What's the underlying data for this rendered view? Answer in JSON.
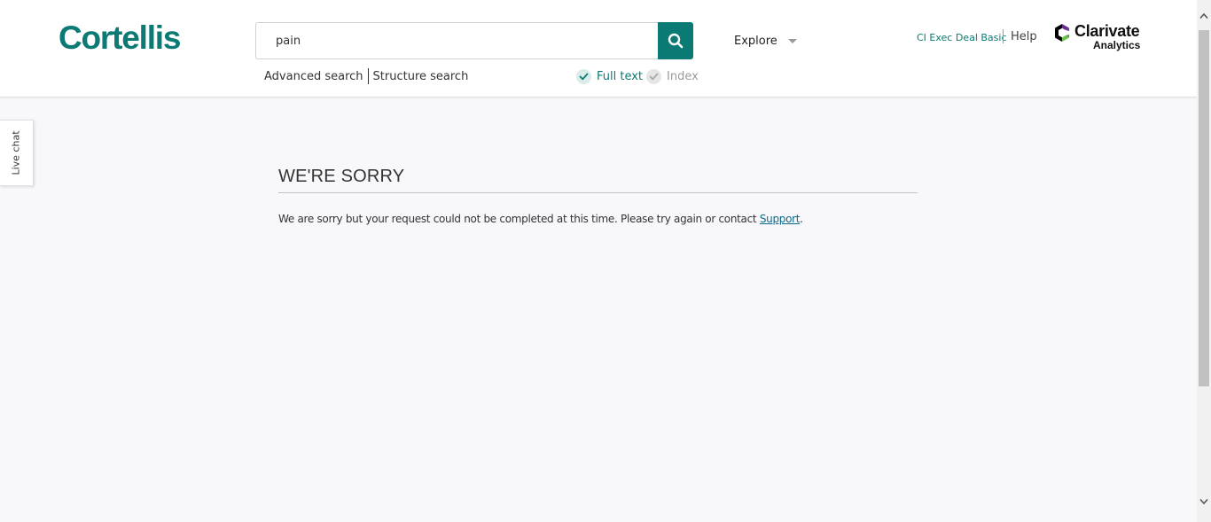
{
  "header": {
    "logo": "Cortellis",
    "search": {
      "value": "pain",
      "button_icon": "search-icon"
    },
    "links": {
      "advanced": "Advanced search",
      "structure": "Structure search"
    },
    "options": {
      "full_text": "Full text",
      "index": "Index"
    },
    "explore": "Explore",
    "user": "CI Exec Deal Basic",
    "help": "Help",
    "brand": {
      "name": "Clarivate",
      "sub": "Analytics"
    }
  },
  "live_chat": "Live chat",
  "error": {
    "title": "WE'RE SORRY",
    "message": "We are sorry but your request could not be completed at this time. Please try again or contact ",
    "link": "Support",
    "suffix": "."
  },
  "colors": {
    "accent": "#0b7a74",
    "background": "#f8f8fa",
    "link": "#0b6a8a"
  }
}
